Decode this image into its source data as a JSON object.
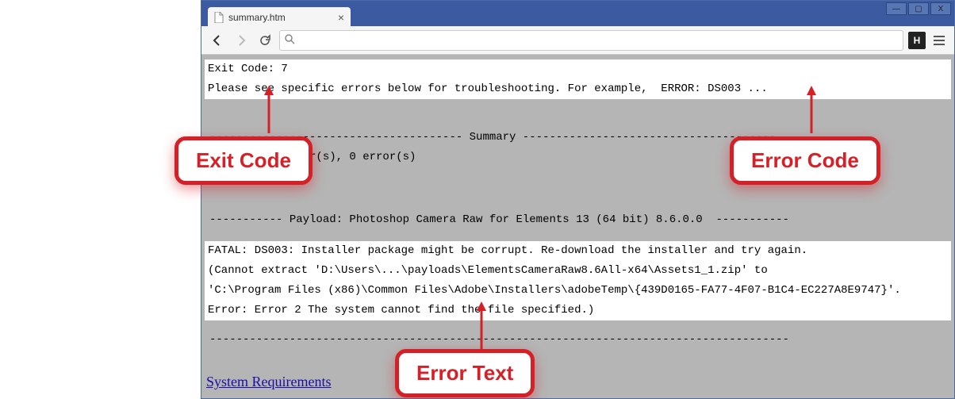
{
  "window": {
    "minimize_label": "—",
    "maximize_label": "▢",
    "close_label": "X"
  },
  "tab": {
    "title": "summary.htm",
    "close_label": "×"
  },
  "omnibox": {
    "value": "",
    "placeholder": ""
  },
  "extension": {
    "letter": "H"
  },
  "content": {
    "line1": "Exit Code: 7",
    "line2": "Please see specific errors below for troubleshooting. For example,  ERROR: DS003 ...",
    "summary_header": "-------------------------------------- Summary --------------------------------------",
    "summary_counts": " - 1 fatal error(s), 0 error(s)",
    "payload_line": "----------- Payload: Photoshop Camera Raw for Elements 13 (64 bit) 8.6.0.0  -----------",
    "fatal1": "FATAL: DS003: Installer package might be corrupt. Re-download the installer and try again.",
    "fatal2": "(Cannot extract 'D:\\Users\\...\\payloads\\ElementsCameraRaw8.6All-x64\\Assets1_1.zip' to",
    "fatal3": "'C:\\Program Files (x86)\\Common Files\\Adobe\\Installers\\adobeTemp\\{439D0165-FA77-4F07-B1C4-EC227A8E9747}'.",
    "fatal4": "Error: Error 2 The system cannot find the file specified.)",
    "divider": "---------------------------------------------------------------------------------------",
    "link": "System Requirements"
  },
  "callouts": {
    "exit_code": "Exit Code",
    "error_code": "Error Code",
    "error_text": "Error Text"
  },
  "colors": {
    "callout_red": "#d62027",
    "browser_chrome": "#3b5aa0",
    "viewport_bg": "#b5b5b5"
  }
}
